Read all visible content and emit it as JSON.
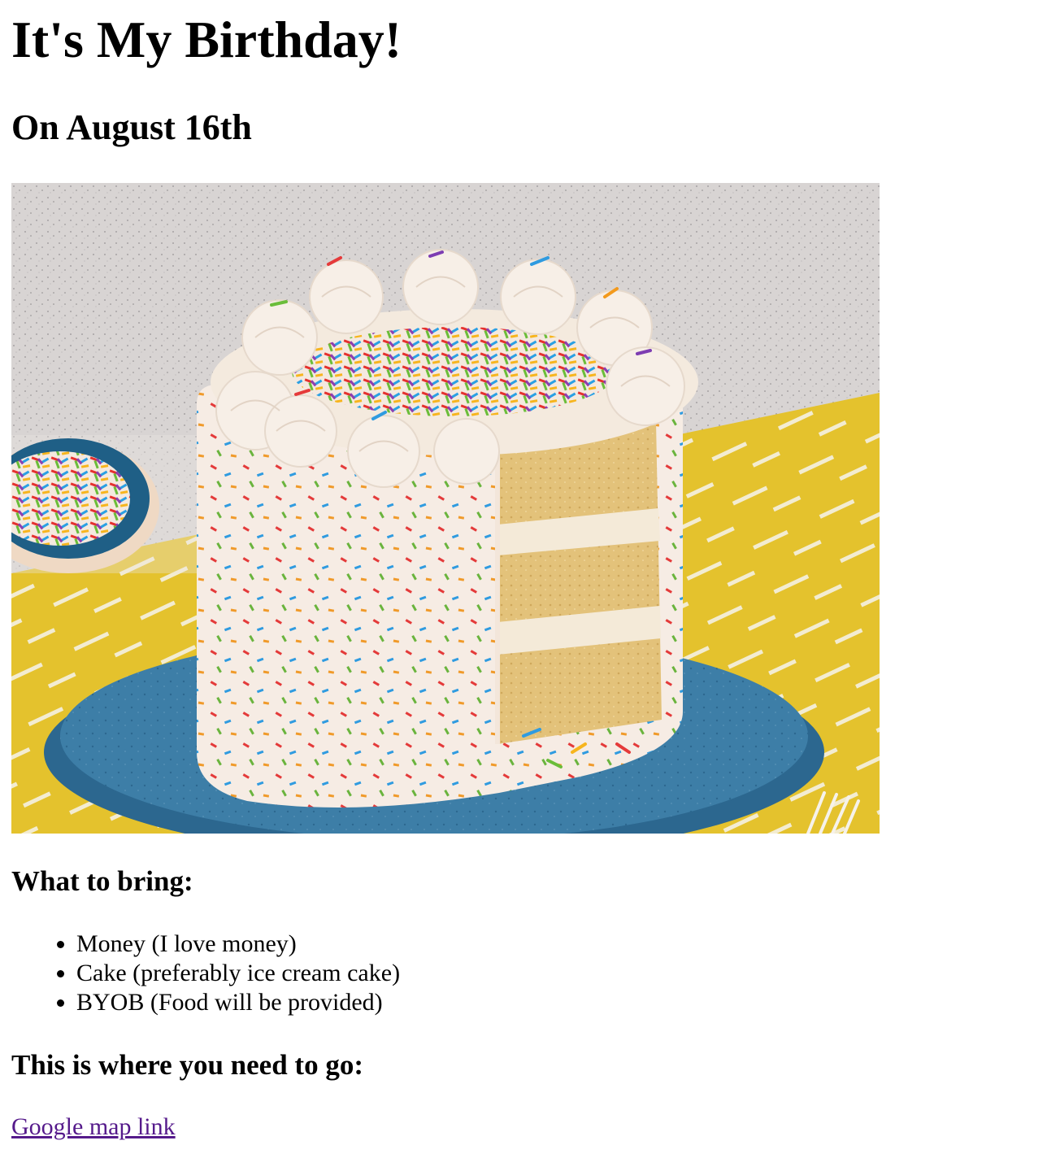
{
  "page": {
    "title": "It's My Birthday!",
    "subtitle": "On August 16th"
  },
  "photo": {
    "subject": "cake-photo",
    "colors": {
      "backdrop": "#d7d3d2",
      "tablecloth": "#e6c62e",
      "plate": "#3b7ca6",
      "frosting": "#f6ece4",
      "sponge": "#e2c37d"
    }
  },
  "bring": {
    "heading": "What to bring:",
    "items": [
      "Money (I love money)",
      "Cake (preferably ice cream cake)",
      "BYOB (Food will be provided)"
    ]
  },
  "location": {
    "heading": "This is where you need to go:",
    "link_text": "Google map link"
  }
}
